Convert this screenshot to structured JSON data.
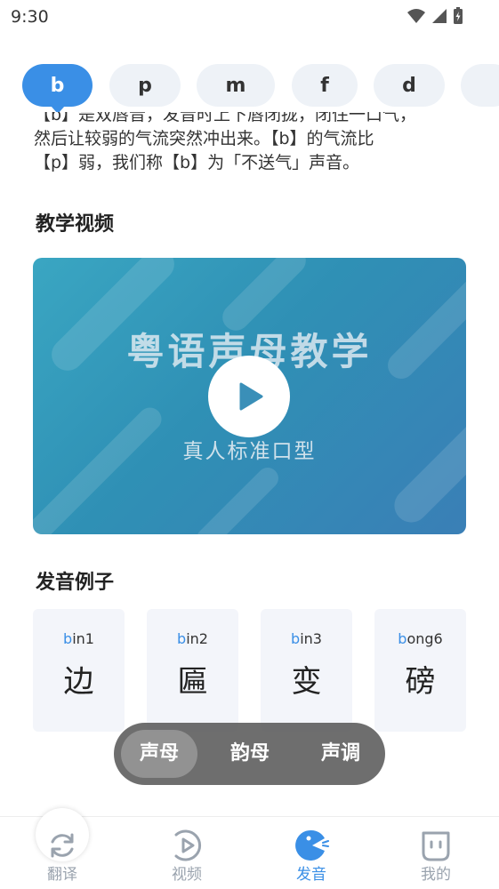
{
  "status": {
    "time": "9:30"
  },
  "chips": [
    {
      "label": "b",
      "active": true
    },
    {
      "label": "p"
    },
    {
      "label": "m"
    },
    {
      "label": "f"
    },
    {
      "label": "d"
    },
    {
      "label": ""
    }
  ],
  "description": {
    "line1": "【b】是双唇音，发音时上下唇闭拢，闭住一口气，",
    "line2": "然后让较弱的气流突然冲出来。【b】的气流比",
    "line3": "【p】弱，我们称【b】为「不送气」声音。"
  },
  "video_section": {
    "heading": "教学视频",
    "overlay_title": "粤语声母教学",
    "overlay_subtitle": "真人标准口型"
  },
  "examples_section": {
    "heading": "发音例子",
    "items": [
      {
        "initial": "b",
        "rest": "in1",
        "char": "边"
      },
      {
        "initial": "b",
        "rest": "in2",
        "char": "匾"
      },
      {
        "initial": "b",
        "rest": "in3",
        "char": "变"
      },
      {
        "initial": "b",
        "rest": "ong6",
        "char": "磅"
      }
    ]
  },
  "segments": [
    {
      "label": "声母",
      "active": true
    },
    {
      "label": "韵母"
    },
    {
      "label": "声调"
    }
  ],
  "tabs": [
    {
      "label": "翻译",
      "icon": "refresh-icon"
    },
    {
      "label": "视频",
      "icon": "video-play-icon"
    },
    {
      "label": "发音",
      "icon": "pronounce-icon",
      "active": true
    },
    {
      "label": "我的",
      "icon": "profile-face-icon"
    }
  ],
  "colors": {
    "accent": "#3a8fe6",
    "chip_bg": "#eef2f7",
    "card_bg": "#f3f5fa"
  }
}
